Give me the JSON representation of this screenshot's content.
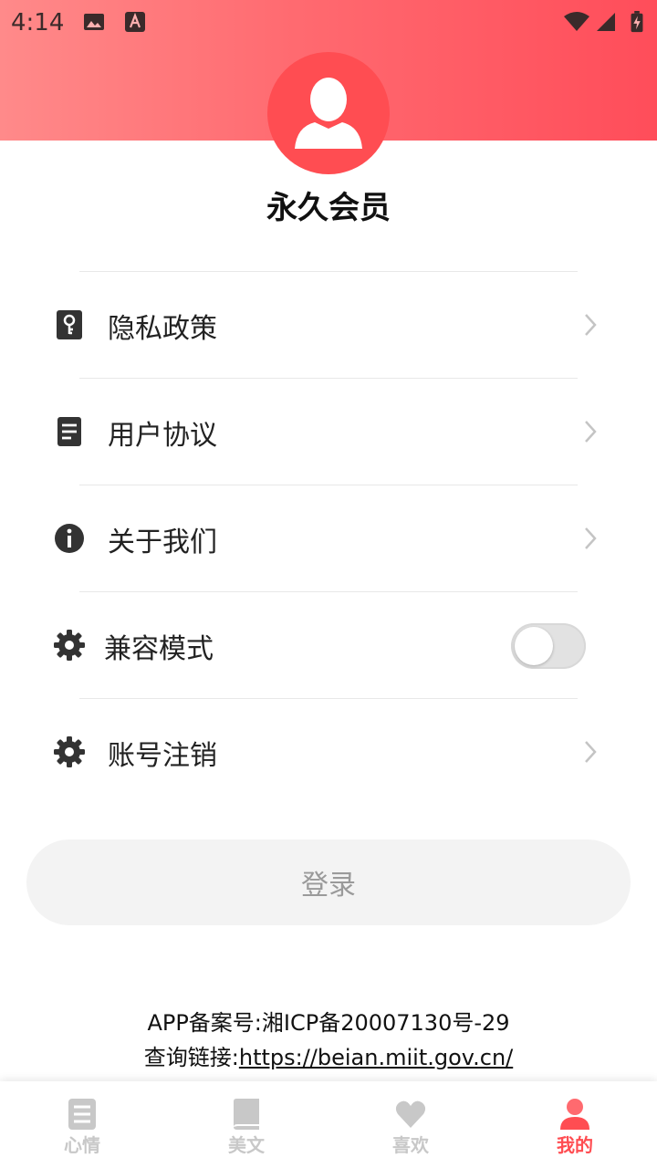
{
  "status_bar": {
    "time": "4:14"
  },
  "profile": {
    "username": "永久会员"
  },
  "menu": {
    "items": [
      {
        "label": "隐私政策",
        "icon": "key-icon",
        "type": "link"
      },
      {
        "label": "用户协议",
        "icon": "document-icon",
        "type": "link"
      },
      {
        "label": "关于我们",
        "icon": "info-icon",
        "type": "link"
      },
      {
        "label": "兼容模式",
        "icon": "gear-icon",
        "type": "toggle",
        "enabled": false
      },
      {
        "label": "账号注销",
        "icon": "gear-icon",
        "type": "link"
      }
    ]
  },
  "login": {
    "label": "登录"
  },
  "footer": {
    "icp_line": "APP备案号:湘ICP备20007130号-29",
    "query_prefix": "查询链接:",
    "query_url": "https://beian.miit.gov.cn/"
  },
  "tabs": [
    {
      "label": "心情",
      "icon": "note-icon",
      "active": false
    },
    {
      "label": "美文",
      "icon": "book-icon",
      "active": false
    },
    {
      "label": "喜欢",
      "icon": "heart-icon",
      "active": false
    },
    {
      "label": "我的",
      "icon": "person-icon",
      "active": true
    }
  ],
  "colors": {
    "accent": "#ff4d52",
    "header_start": "#ff8a8a",
    "header_end": "#ff4d5a",
    "tab_inactive": "#c8c8c8"
  }
}
